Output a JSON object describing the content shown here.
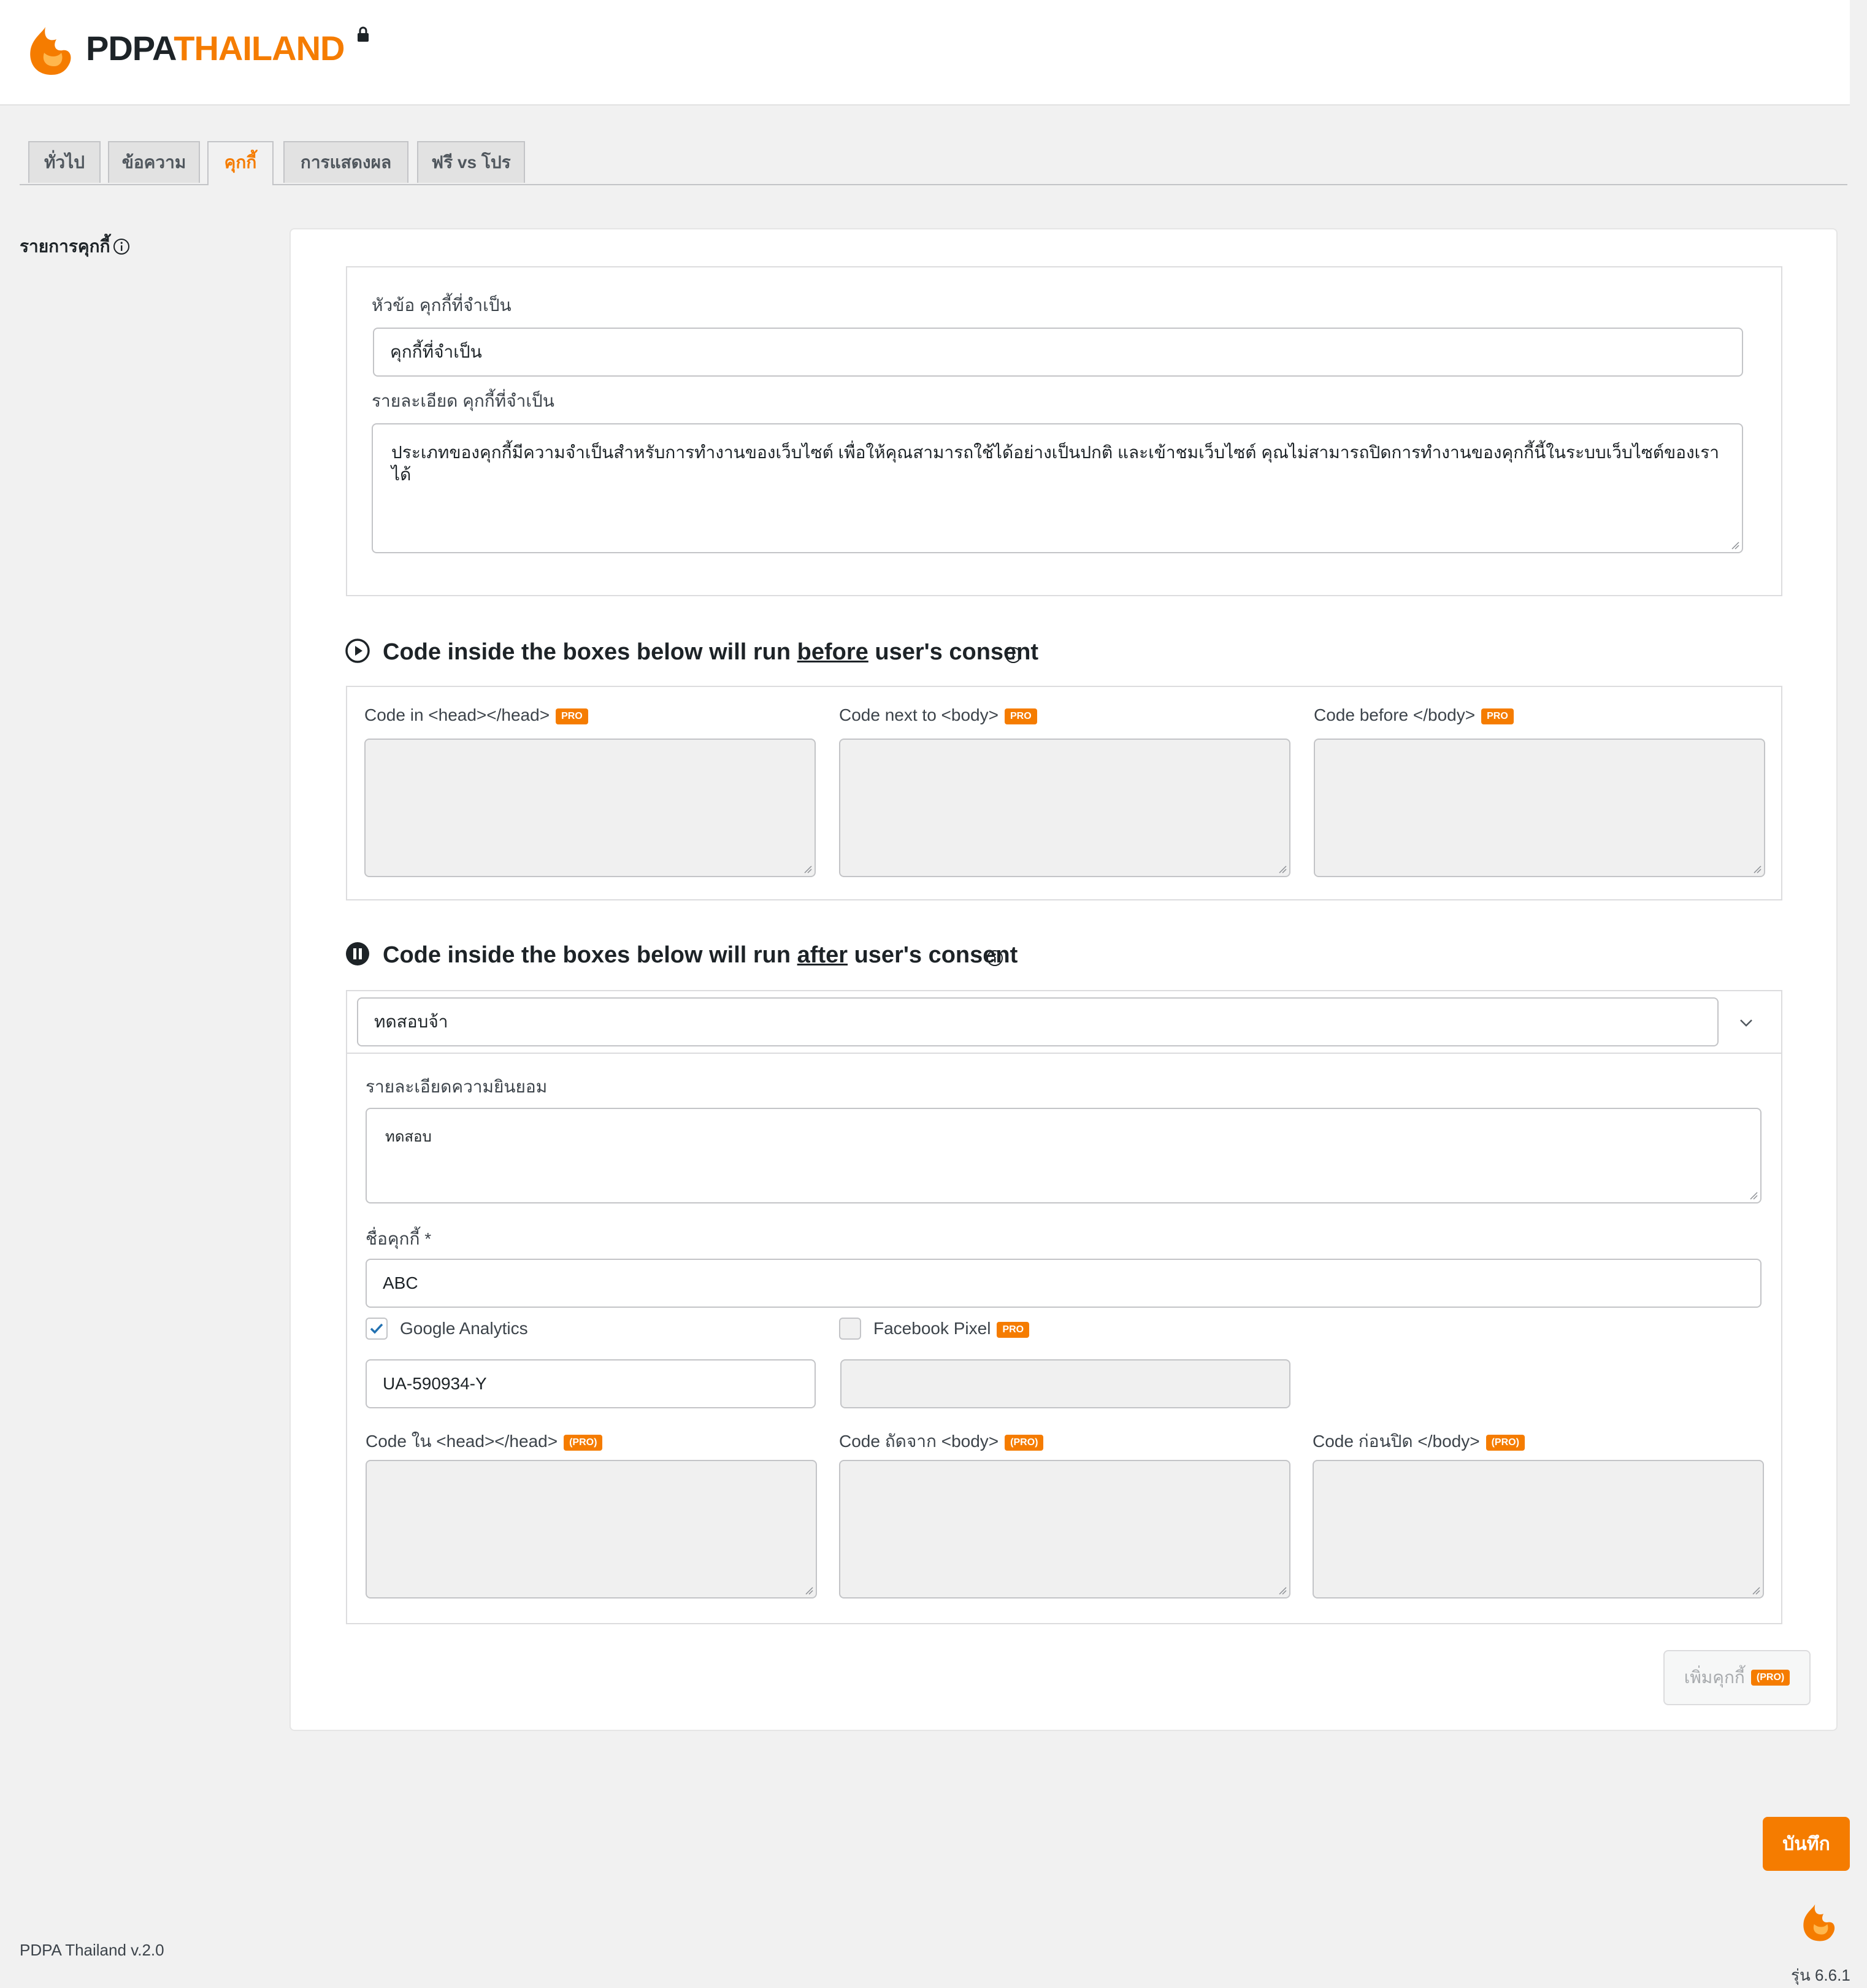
{
  "brand": {
    "name_part1": "PDPA",
    "name_part2": "THAILAND"
  },
  "tabs": [
    {
      "label": "ทั่วไป"
    },
    {
      "label": "ข้อความ"
    },
    {
      "label": "คุกกี้"
    },
    {
      "label": "การแสดงผล"
    },
    {
      "label": "ฟรี vs โปร"
    }
  ],
  "sidebar": {
    "label": "รายการคุกกี้"
  },
  "necessary": {
    "title_label": "หัวข้อ คุกกี้ที่จำเป็น",
    "title_value": "คุกกี้ที่จำเป็น",
    "desc_label": "รายละเอียด คุกกี้ที่จำเป็น",
    "desc_value": "ประเภทของคุกกี้มีความจำเป็นสำหรับการทำงานของเว็บไซต์ เพื่อให้คุณสามารถใช้ได้อย่างเป็นปกติ และเข้าชมเว็บไซต์ คุณไม่สามารถปิดการทำงานของคุกกี้นี้ในระบบเว็บไซต์ของเราได้"
  },
  "before_section": {
    "title_pre": "Code inside the boxes below will run ",
    "title_em": "before",
    "title_post": " user's consent",
    "code_head_label": "Code in <head></head>",
    "code_body_open_label": "Code next to <body>",
    "code_body_close_label": "Code before </body>",
    "pro_badge": "PRO"
  },
  "after_section": {
    "title_pre": "Code inside the boxes below will run ",
    "title_em": "after",
    "title_post": " user's consent",
    "group_name_value": "ทดสอบจ้า",
    "consent_desc_label": "รายละเอียดความยินยอม",
    "consent_desc_value": "ทดสอบ",
    "cookie_name_label": "ชื่อคุกกี้ *",
    "cookie_name_value": "ABC",
    "ga_label": "Google Analytics",
    "ga_checked": true,
    "ga_value": "UA-590934-Y",
    "fb_label": "Facebook Pixel",
    "fb_checked": false,
    "pro_badge": "PRO",
    "pro_badge_paren": "(PRO)",
    "code_head_label": "Code ใน <head></head>",
    "code_body_open_label": "Code ถัดจาก <body>",
    "code_body_close_label": "Code ก่อนปิด </body>"
  },
  "add_cookie": {
    "label": "เพิ่มคุกกี้",
    "badge": "(PRO)"
  },
  "save_label": "บันทึก",
  "footer": {
    "plugin_version": "PDPA Thailand v.2.0",
    "wp_version": "รุ่น 6.6.1"
  },
  "colors": {
    "accent": "#f57c00",
    "tab_bg": "#e2e2e2",
    "page_bg": "#f1f1f1"
  }
}
